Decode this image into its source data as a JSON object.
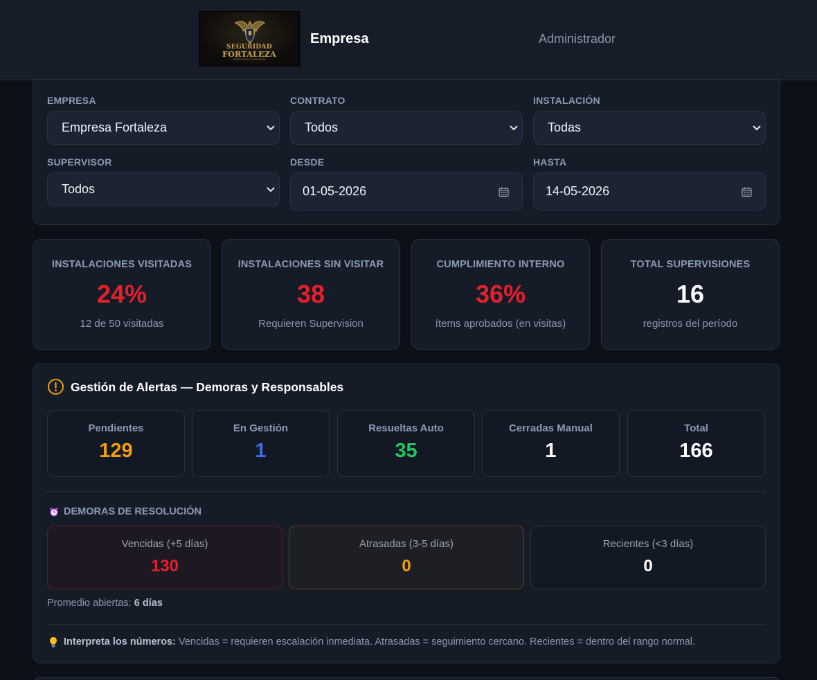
{
  "header": {
    "logo": {
      "line1": "SEGURIDAD",
      "line2": "FORTALEZA",
      "line3": "PROTECCIÓN Y CONFIANZA"
    },
    "company": "Empresa",
    "role": "Administrador"
  },
  "filters": {
    "empresa": {
      "label": "EMPRESA",
      "value": "Empresa Fortaleza"
    },
    "contrato": {
      "label": "CONTRATO",
      "value": "Todos"
    },
    "instalacion": {
      "label": "INSTALACIÓN",
      "value": "Todas"
    },
    "supervisor": {
      "label": "SUPERVISOR",
      "value": "Todos"
    },
    "desde": {
      "label": "DESDE",
      "value": "01-05-2026"
    },
    "hasta": {
      "label": "HASTA",
      "value": "14-05-2026"
    }
  },
  "kpis": [
    {
      "title": "INSTALACIONES VISITADAS",
      "value": "24%",
      "sub": "12 de 50 visitadas",
      "color": "#e5202b"
    },
    {
      "title": "INSTALACIONES SIN VISITAR",
      "value": "38",
      "sub": "Requieren Supervision",
      "color": "#e5202b"
    },
    {
      "title": "CUMPLIMIENTO INTERNO",
      "value": "36%",
      "sub": "ítems aprobados (en visitas)",
      "color": "#e5202b"
    },
    {
      "title": "TOTAL SUPERVISIONES",
      "value": "16",
      "sub": "registros del período",
      "color": "#ffffff"
    }
  ],
  "alerts": {
    "title": "Gestión de Alertas — Demoras y Responsables",
    "stats": [
      {
        "label": "Pendientes",
        "value": "129",
        "color": "#f59e0b"
      },
      {
        "label": "En Gestión",
        "value": "1",
        "color": "#3b6fe6"
      },
      {
        "label": "Resueltas Auto",
        "value": "35",
        "color": "#22c55e"
      },
      {
        "label": "Cerradas Manual",
        "value": "1",
        "color": "#ffffff"
      },
      {
        "label": "Total",
        "value": "166",
        "color": "#ffffff"
      }
    ],
    "demoras_title": "DEMORAS DE RESOLUCIÓN",
    "demoras": [
      {
        "label": "Vencidas (+5 días)",
        "value": "130",
        "color": "#e5202b"
      },
      {
        "label": "Atrasadas (3-5 días)",
        "value": "0",
        "color": "#f59e0b"
      },
      {
        "label": "Recientes (<3 días)",
        "value": "0",
        "color": "#ffffff"
      }
    ],
    "avg_label": "Promedio abiertas:",
    "avg_value": "6 días",
    "tip_label": "Interpreta los números:",
    "tip_text": "Vencidas = requieren escalación inmediata. Atrasadas = seguimiento cercano. Recientes = dentro del rango normal."
  }
}
